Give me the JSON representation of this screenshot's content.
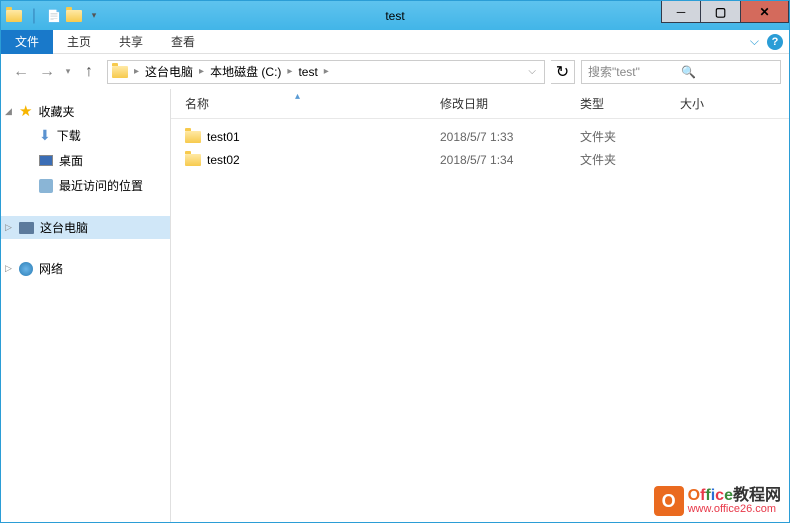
{
  "window": {
    "title": "test"
  },
  "ribbon": {
    "file": "文件",
    "tabs": [
      "主页",
      "共享",
      "查看"
    ]
  },
  "nav": {
    "breadcrumb": [
      "这台电脑",
      "本地磁盘 (C:)",
      "test"
    ],
    "search_placeholder": "搜索\"test\""
  },
  "sidebar": {
    "favorites": {
      "label": "收藏夹",
      "items": [
        "下载",
        "桌面",
        "最近访问的位置"
      ]
    },
    "thispc": {
      "label": "这台电脑"
    },
    "network": {
      "label": "网络"
    }
  },
  "columns": {
    "name": "名称",
    "date": "修改日期",
    "type": "类型",
    "size": "大小"
  },
  "files": [
    {
      "name": "test01",
      "date": "2018/5/7 1:33",
      "type": "文件夹"
    },
    {
      "name": "test02",
      "date": "2018/5/7 1:34",
      "type": "文件夹"
    }
  ],
  "watermark": {
    "brand": "Office教程网",
    "url": "www.office26.com"
  }
}
